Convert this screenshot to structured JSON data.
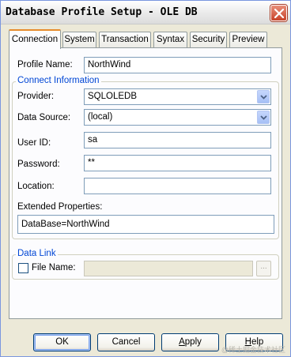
{
  "window": {
    "title": "Database Profile Setup - OLE DB",
    "close_icon": "close-icon"
  },
  "tabs": [
    {
      "label": "Connection",
      "active": true
    },
    {
      "label": "System",
      "active": false
    },
    {
      "label": "Transaction",
      "active": false
    },
    {
      "label": "Syntax",
      "active": false
    },
    {
      "label": "Security",
      "active": false
    },
    {
      "label": "Preview",
      "active": false
    }
  ],
  "connection": {
    "profile_name_label": "Profile Name:",
    "profile_name_value": "NorthWind",
    "group_title": "Connect Information",
    "provider_label": "Provider:",
    "provider_value": "SQLOLEDB",
    "data_source_label": "Data Source:",
    "data_source_value": "(local)",
    "user_id_label": "User ID:",
    "user_id_value": "sa",
    "password_label": "Password:",
    "password_value": "**",
    "location_label": "Location:",
    "location_value": "",
    "extended_label": "Extended Properties:",
    "extended_value": "DataBase=NorthWind"
  },
  "data_link": {
    "group_title": "Data Link",
    "file_name_label": "File Name:",
    "file_name_checked": false,
    "file_name_value": "",
    "browse_label": "..."
  },
  "buttons": {
    "ok": "OK",
    "cancel": "Cancel",
    "apply_prefix": "",
    "apply_mnemonic": "A",
    "apply_rest": "pply",
    "help_mnemonic": "H",
    "help_rest": "elp"
  },
  "watermark": "@稀土掘金技术社区",
  "colors": {
    "dialog_background": "#ECE9D8",
    "group_title": "#0046d5",
    "active_tab_accent": "#e68b2c"
  }
}
